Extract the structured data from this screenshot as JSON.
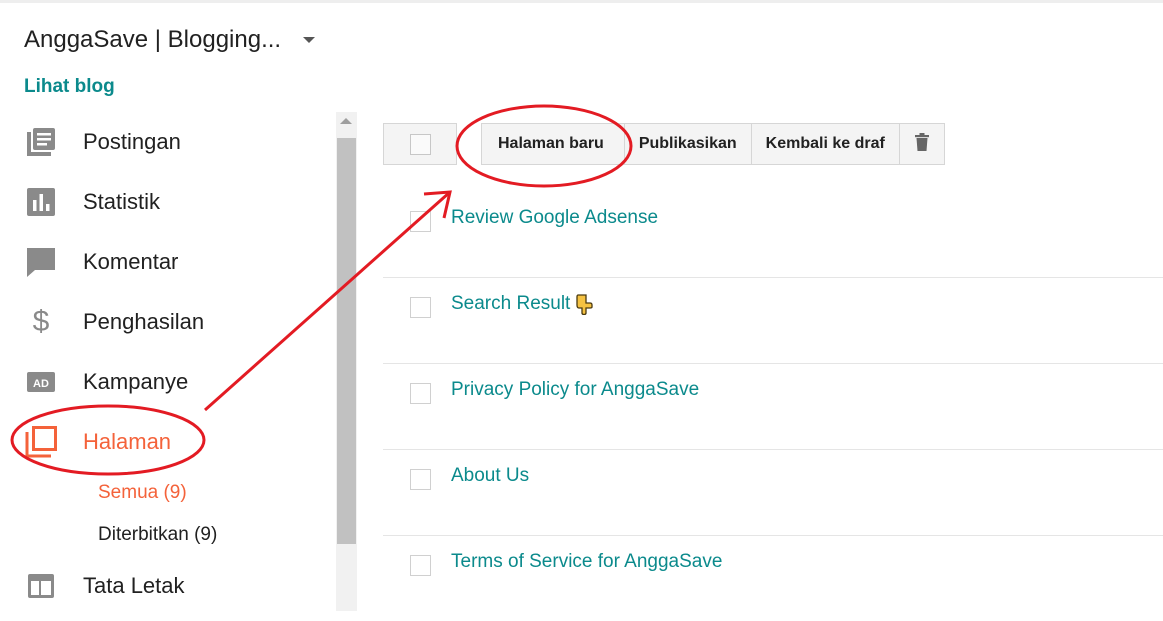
{
  "header": {
    "blog_title": "AnggaSave | Blogging...",
    "view_blog_label": "Lihat blog"
  },
  "sidebar": {
    "items": [
      {
        "label": "Postingan",
        "icon": "posts-icon"
      },
      {
        "label": "Statistik",
        "icon": "stats-icon"
      },
      {
        "label": "Komentar",
        "icon": "comment-icon"
      },
      {
        "label": "Penghasilan",
        "icon": "dollar-icon"
      },
      {
        "label": "Kampanye",
        "icon": "ad-icon"
      },
      {
        "label": "Halaman",
        "icon": "pages-icon",
        "active": true
      },
      {
        "label": "Tata Letak",
        "icon": "layout-icon"
      }
    ],
    "subitems": [
      {
        "label": "Semua (9)",
        "active": true
      },
      {
        "label": "Diterbitkan (9)"
      }
    ]
  },
  "toolbar": {
    "new_page_label": "Halaman baru",
    "publish_label": "Publikasikan",
    "revert_label": "Kembali ke draf",
    "delete_icon": "trash-icon"
  },
  "pages": [
    {
      "title": "Review Google Adsense"
    },
    {
      "title": "Search Result",
      "emoji": "pointing-down-hand-icon"
    },
    {
      "title": "Privacy Policy for AnggaSave"
    },
    {
      "title": "About Us"
    },
    {
      "title": "Terms of Service for AnggaSave"
    }
  ],
  "colors": {
    "accent": "#f4623a",
    "link": "#0b8a8c",
    "annotation": "#e31b23"
  }
}
